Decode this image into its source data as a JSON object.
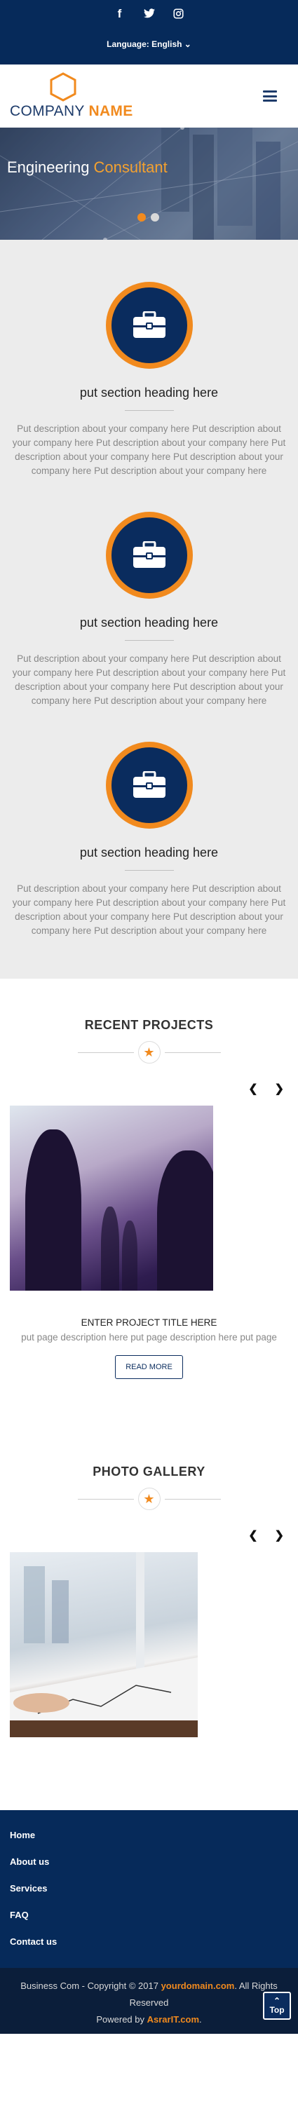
{
  "social": {
    "facebook_icon": "f",
    "twitter_icon": "t",
    "instagram_icon": "◎"
  },
  "language": {
    "label": "Language: English ⌄"
  },
  "logo": {
    "company": "COMPANY",
    "name": "NAME"
  },
  "hero": {
    "title_plain": "Engineering ",
    "title_accent": "Consultant",
    "dot_colors": [
      "#f18a1e",
      "#d9d9d9"
    ]
  },
  "features": [
    {
      "heading": "put section heading here",
      "description": "Put description about your company here Put description about your company here Put description about your company here Put description about your company here Put description about your company here Put description about your company here"
    },
    {
      "heading": "put section heading here",
      "description": "Put description about your company here Put description about your company here Put description about your company here Put description about your company here Put description about your company here Put description about your company here"
    },
    {
      "heading": "put section heading here",
      "description": "Put description about your company here Put description about your company here Put description about your company here Put description about your company here Put description about your company here Put description about your company here"
    }
  ],
  "projects": {
    "title": "RECENT PROJECTS",
    "prev": "❮",
    "next": "❯",
    "item_title": "ENTER PROJECT TITLE HERE",
    "item_desc": "put page description here put page description here put page",
    "read_more": "READ MORE"
  },
  "gallery": {
    "title": "PHOTO GALLERY",
    "prev": "❮",
    "next": "❯"
  },
  "footer": {
    "links": [
      "Home",
      "About us",
      "Services",
      "FAQ",
      "Contact us"
    ]
  },
  "bottom": {
    "copy_pre": "Business Com - Copyright © 2017 ",
    "domain": "yourdomain.com",
    "copy_post": ". All Rights Reserved",
    "powered_pre": "Powered by ",
    "powered_link": "AsrarIT.com",
    "powered_post": ".",
    "top_label": "Top",
    "top_arrow": "⌃"
  },
  "colors": {
    "navy": "#062a5a",
    "orange": "#f18a1e"
  }
}
